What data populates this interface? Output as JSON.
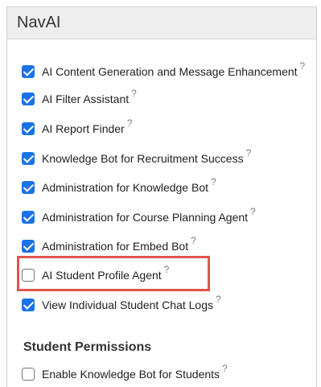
{
  "panel": {
    "title": "NavAI"
  },
  "permissions": [
    {
      "label": "AI Content Generation and Message Enhancement",
      "checked": true,
      "help_icon": "?"
    },
    {
      "label": "AI Filter Assistant",
      "checked": true,
      "help_icon": "?"
    },
    {
      "label": "AI Report Finder",
      "checked": true,
      "help_icon": "?"
    },
    {
      "label": "Knowledge Bot for Recruitment Success",
      "checked": true,
      "help_icon": "?"
    },
    {
      "label": "Administration for Knowledge Bot",
      "checked": true,
      "help_icon": "?"
    },
    {
      "label": "Administration for Course Planning Agent",
      "checked": true,
      "help_icon": "?"
    },
    {
      "label": "Administration for Embed Bot",
      "checked": true,
      "help_icon": "?"
    },
    {
      "label": "AI Student Profile Agent",
      "checked": false,
      "help_icon": "?",
      "highlighted": true
    },
    {
      "label": "View Individual Student Chat Logs",
      "checked": true,
      "help_icon": "?"
    }
  ],
  "student_section": {
    "heading": "Student Permissions",
    "permissions": [
      {
        "label": "Enable Knowledge Bot for Students",
        "checked": false,
        "help_icon": "?"
      }
    ]
  },
  "colors": {
    "checkbox_checked": "#1a73e8",
    "highlight_border": "#e0544f",
    "header_background": "#eeeeee"
  }
}
